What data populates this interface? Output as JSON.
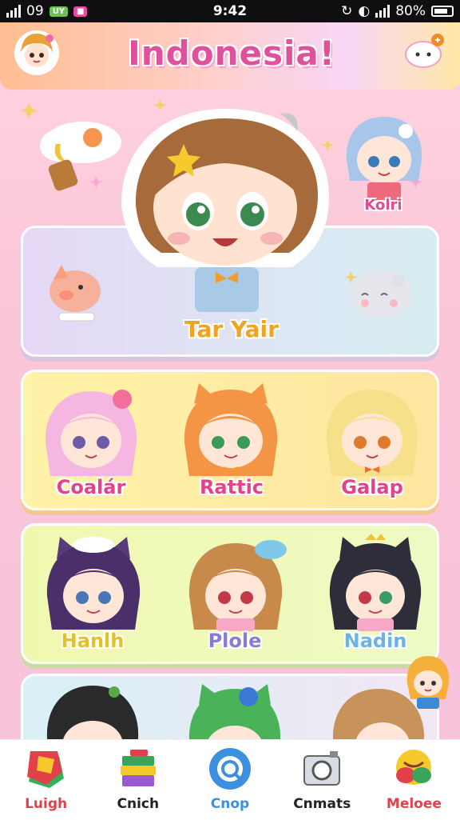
{
  "status_bar": {
    "left_text": "09",
    "carrier_pill": "UY",
    "time": "9:42",
    "battery_text": "80%"
  },
  "header": {
    "title": "Indonesia!"
  },
  "featured": {
    "name": "Tar Yair",
    "side_name": "Kolri"
  },
  "rows": [
    {
      "characters": [
        {
          "name": "Coalár"
        },
        {
          "name": "Rattic"
        },
        {
          "name": "Galap"
        }
      ]
    },
    {
      "characters": [
        {
          "name": "Hanlh"
        },
        {
          "name": "Plole"
        },
        {
          "name": "Nadin"
        }
      ]
    }
  ],
  "tabs": [
    {
      "label": "Luigh",
      "color": "#e2404a",
      "icon": "star-icon"
    },
    {
      "label": "Cnich",
      "color": "#222222",
      "icon": "books-icon"
    },
    {
      "label": "Cnop",
      "color": "#3d8fe0",
      "icon": "search-icon"
    },
    {
      "label": "Cnmats",
      "color": "#222222",
      "icon": "camera-icon"
    },
    {
      "label": "Meloee",
      "color": "#e2404a",
      "icon": "smile-icon"
    }
  ],
  "colors": {
    "title": "#e0519b",
    "featured_label": "#f0a323",
    "accent_pink": "#f3a0c8"
  }
}
